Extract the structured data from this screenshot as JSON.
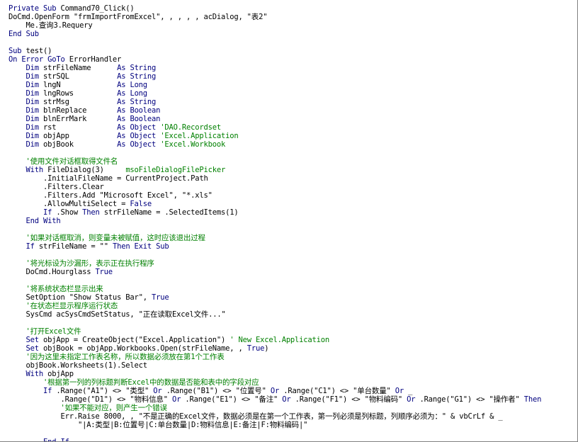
{
  "window": {
    "title": ""
  },
  "colors": {
    "keyword": "#00007f",
    "comment": "#008000",
    "text": "#000000",
    "background": "#ffffff"
  },
  "code": {
    "lines": [
      [
        [
          "kw",
          "Private Sub"
        ],
        [
          "tx",
          " Command70_Click()"
        ]
      ],
      [
        [
          "tx",
          "DoCmd.OpenForm \"frmImportFromExcel\", , , , , acDialog, \"表2\""
        ]
      ],
      [
        [
          "tx",
          "    Me.查询3.Requery"
        ]
      ],
      [
        [
          "kw",
          "End Sub"
        ]
      ],
      [
        [
          "tx",
          ""
        ]
      ],
      [
        [
          "kw",
          "Sub"
        ],
        [
          "tx",
          " test()"
        ]
      ],
      [
        [
          "kw",
          "On Error GoTo"
        ],
        [
          "tx",
          " ErrorHandler"
        ]
      ],
      [
        [
          "tx",
          "    "
        ],
        [
          "kw",
          "Dim"
        ],
        [
          "tx",
          " strFileName      "
        ],
        [
          "kw",
          "As String"
        ]
      ],
      [
        [
          "tx",
          "    "
        ],
        [
          "kw",
          "Dim"
        ],
        [
          "tx",
          " strSQL           "
        ],
        [
          "kw",
          "As String"
        ]
      ],
      [
        [
          "tx",
          "    "
        ],
        [
          "kw",
          "Dim"
        ],
        [
          "tx",
          " lngN             "
        ],
        [
          "kw",
          "As Long"
        ]
      ],
      [
        [
          "tx",
          "    "
        ],
        [
          "kw",
          "Dim"
        ],
        [
          "tx",
          " lngRows          "
        ],
        [
          "kw",
          "As Long"
        ]
      ],
      [
        [
          "tx",
          "    "
        ],
        [
          "kw",
          "Dim"
        ],
        [
          "tx",
          " strMsg           "
        ],
        [
          "kw",
          "As String"
        ]
      ],
      [
        [
          "tx",
          "    "
        ],
        [
          "kw",
          "Dim"
        ],
        [
          "tx",
          " blnReplace       "
        ],
        [
          "kw",
          "As Boolean"
        ]
      ],
      [
        [
          "tx",
          "    "
        ],
        [
          "kw",
          "Dim"
        ],
        [
          "tx",
          " blnErrMark       "
        ],
        [
          "kw",
          "As Boolean"
        ]
      ],
      [
        [
          "tx",
          "    "
        ],
        [
          "kw",
          "Dim"
        ],
        [
          "tx",
          " rst              "
        ],
        [
          "kw",
          "As Object"
        ],
        [
          "cm",
          " 'DAO.Recordset"
        ]
      ],
      [
        [
          "tx",
          "    "
        ],
        [
          "kw",
          "Dim"
        ],
        [
          "tx",
          " objApp           "
        ],
        [
          "kw",
          "As Object"
        ],
        [
          "cm",
          " 'Excel.Application"
        ]
      ],
      [
        [
          "tx",
          "    "
        ],
        [
          "kw",
          "Dim"
        ],
        [
          "tx",
          " objBook          "
        ],
        [
          "kw",
          "As Object"
        ],
        [
          "cm",
          " 'Excel.Workbook"
        ]
      ],
      [
        [
          "tx",
          ""
        ]
      ],
      [
        [
          "cm",
          "    '使用文件对话框取得文件名"
        ]
      ],
      [
        [
          "tx",
          "    "
        ],
        [
          "kw",
          "With"
        ],
        [
          "tx",
          " FileDialog(3)     "
        ],
        [
          "cm",
          "msoFileDialogFilePicker"
        ]
      ],
      [
        [
          "tx",
          "        .InitialFileName = CurrentProject.Path"
        ]
      ],
      [
        [
          "tx",
          "        .Filters.Clear"
        ]
      ],
      [
        [
          "tx",
          "        .Filters.Add \"Microsoft Excel\", \"*.xls\""
        ]
      ],
      [
        [
          "tx",
          "        .AllowMultiSelect = "
        ],
        [
          "kw",
          "False"
        ]
      ],
      [
        [
          "tx",
          "        "
        ],
        [
          "kw",
          "If"
        ],
        [
          "tx",
          " .Show "
        ],
        [
          "kw",
          "Then"
        ],
        [
          "tx",
          " strFileName = .SelectedItems(1)"
        ]
      ],
      [
        [
          "tx",
          "    "
        ],
        [
          "kw",
          "End With"
        ]
      ],
      [
        [
          "tx",
          ""
        ]
      ],
      [
        [
          "cm",
          "    '如果对话框取消，则变量未被赋值，这时应该退出过程"
        ]
      ],
      [
        [
          "tx",
          "    "
        ],
        [
          "kw",
          "If"
        ],
        [
          "tx",
          " strFileName = \"\" "
        ],
        [
          "kw",
          "Then Exit Sub"
        ]
      ],
      [
        [
          "tx",
          ""
        ]
      ],
      [
        [
          "cm",
          "    '将光标设为沙漏形，表示正在执行程序"
        ]
      ],
      [
        [
          "tx",
          "    DoCmd.Hourglass "
        ],
        [
          "kw",
          "True"
        ]
      ],
      [
        [
          "tx",
          ""
        ]
      ],
      [
        [
          "cm",
          "    '将系统状态栏显示出来"
        ]
      ],
      [
        [
          "tx",
          "    SetOption \"Show Status Bar\", "
        ],
        [
          "kw",
          "True"
        ]
      ],
      [
        [
          "cm",
          "    '在状态栏显示程序运行状态"
        ]
      ],
      [
        [
          "tx",
          "    SysCmd acSysCmdSetStatus, \"正在读取Excel文件...\""
        ]
      ],
      [
        [
          "tx",
          ""
        ]
      ],
      [
        [
          "cm",
          "    '打开Excel文件"
        ]
      ],
      [
        [
          "tx",
          "    "
        ],
        [
          "kw",
          "Set"
        ],
        [
          "tx",
          " objApp = CreateObject(\"Excel.Application\") "
        ],
        [
          "cm",
          "' New Excel.Application"
        ]
      ],
      [
        [
          "tx",
          "    "
        ],
        [
          "kw",
          "Set"
        ],
        [
          "tx",
          " objBook = objApp.Workbooks.Open(strFileName, , "
        ],
        [
          "kw",
          "True"
        ],
        [
          "tx",
          ")"
        ]
      ],
      [
        [
          "cm",
          "    '因为这里未指定工作表名称，所以数据必须放在第1个工作表"
        ]
      ],
      [
        [
          "tx",
          "    objBook.Worksheets(1).Select"
        ]
      ],
      [
        [
          "tx",
          "    "
        ],
        [
          "kw",
          "With"
        ],
        [
          "tx",
          " objApp"
        ]
      ],
      [
        [
          "cm",
          "        '根据第一列的列标题判断Excel中的数据是否能和表中的字段对应"
        ]
      ],
      [
        [
          "tx",
          "        "
        ],
        [
          "kw",
          "If"
        ],
        [
          "tx",
          " .Range(\"A1\") <> \"类型\" "
        ],
        [
          "kw",
          "Or"
        ],
        [
          "tx",
          " .Range(\"B1\") <> \"位置号\" "
        ],
        [
          "kw",
          "Or"
        ],
        [
          "tx",
          " .Range(\"C1\") <> \"单台数量\" "
        ],
        [
          "kw",
          "Or"
        ],
        [
          "tx",
          " _"
        ]
      ],
      [
        [
          "tx",
          "            .Range(\"D1\") <> \"物料信息\" "
        ],
        [
          "kw",
          "Or"
        ],
        [
          "tx",
          " .Range(\"E1\") <> \"备注\" "
        ],
        [
          "kw",
          "Or"
        ],
        [
          "tx",
          " .Range(\"F1\") <> \"物料编码\" "
        ],
        [
          "kw",
          "Or"
        ],
        [
          "tx",
          " .Range(\"G1\") <> \"操作者\" "
        ],
        [
          "kw",
          "Then"
        ]
      ],
      [
        [
          "cm",
          "            '如果不能对应，则产生一个错误"
        ]
      ],
      [
        [
          "tx",
          "            Err.Raise 8000, , \"不是正确的Excel文件，数据必须是在第一个工作表，第一列必须是列标题，列顺序必须为：\" & vbCrLf & _"
        ]
      ],
      [
        [
          "tx",
          "                \"|A:类型|B:位置号|C:单台数量|D:物料信息|E:备注|F:物料编码|\""
        ]
      ],
      [
        [
          "tx",
          ""
        ]
      ],
      [
        [
          "tx",
          "        "
        ],
        [
          "kw",
          "End If"
        ]
      ]
    ]
  }
}
